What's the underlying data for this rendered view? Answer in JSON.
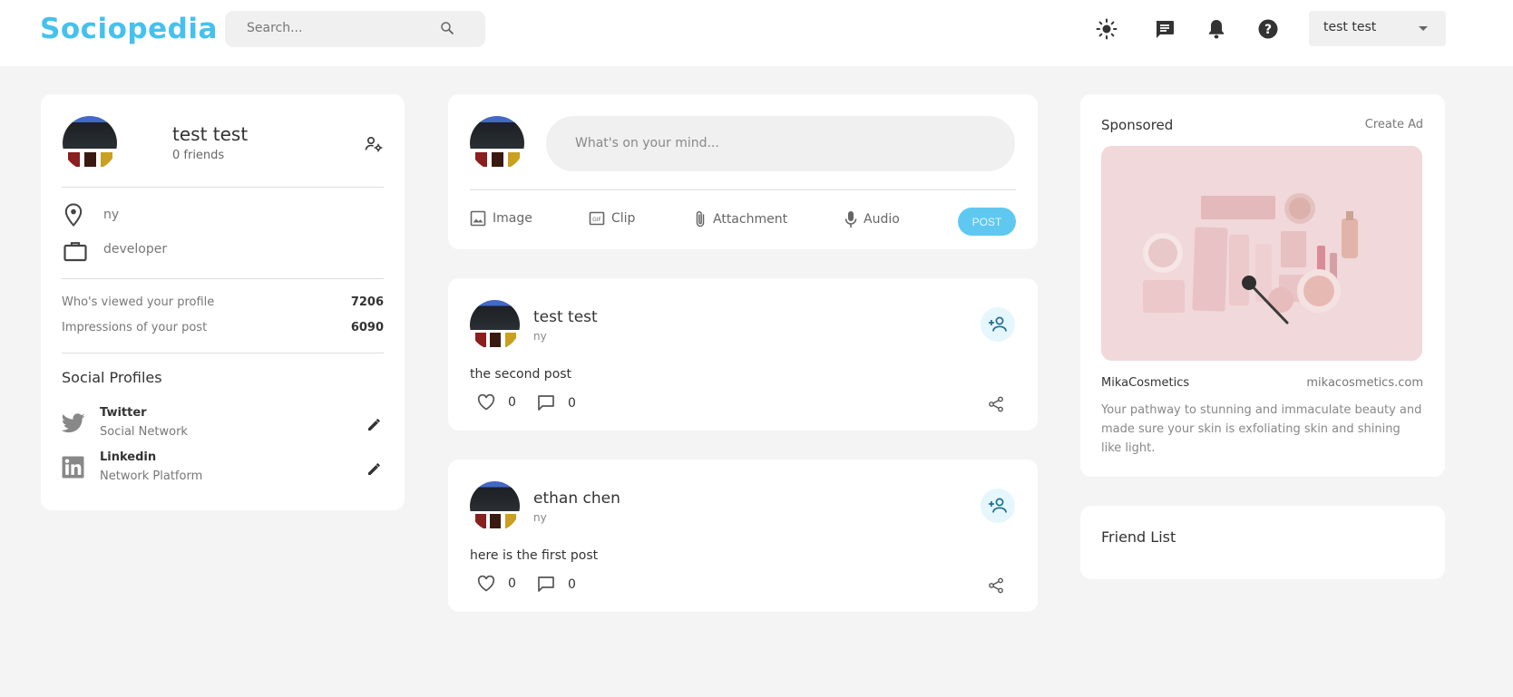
{
  "navbar": {
    "logo": "Sociopedia",
    "search_placeholder": "Search...",
    "icons": [
      "light-mode-icon",
      "message-icon",
      "notification-icon",
      "help-icon"
    ],
    "user_name": "test test"
  },
  "user_widget": {
    "name": "test test",
    "friends": "0 friends",
    "location": "ny",
    "occupation": "developer",
    "stats": [
      {
        "label": "Who's viewed your profile",
        "value": "7206"
      },
      {
        "label": "Impressions of your post",
        "value": "6090"
      }
    ],
    "social_heading": "Social Profiles",
    "social": [
      {
        "name": "Twitter",
        "type": "Social Network",
        "icon": "twitter-icon"
      },
      {
        "name": "Linkedin",
        "type": "Network Platform",
        "icon": "linkedin-icon"
      }
    ]
  },
  "post_form": {
    "placeholder": "What's on your mind...",
    "tools": [
      "Image",
      "Clip",
      "Attachment",
      "Audio"
    ],
    "post_label": "POST"
  },
  "posts": [
    {
      "name": "test test",
      "location": "ny",
      "description": "the second post",
      "likes": "0",
      "comments": "0"
    },
    {
      "name": "ethan chen",
      "location": "ny",
      "description": "here is the first post",
      "likes": "0",
      "comments": "0"
    }
  ],
  "ad": {
    "heading": "Sponsored",
    "create": "Create Ad",
    "company": "MikaCosmetics",
    "site": "mikacosmetics.com",
    "description": "Your pathway to stunning and immaculate beauty and made sure your skin is exfoliating skin and shining like light."
  },
  "friend_list": {
    "heading": "Friend List"
  },
  "colors": {
    "brand": "#45c1ee",
    "background": "#f4f4f4",
    "post_button": "#5fc8f0"
  }
}
